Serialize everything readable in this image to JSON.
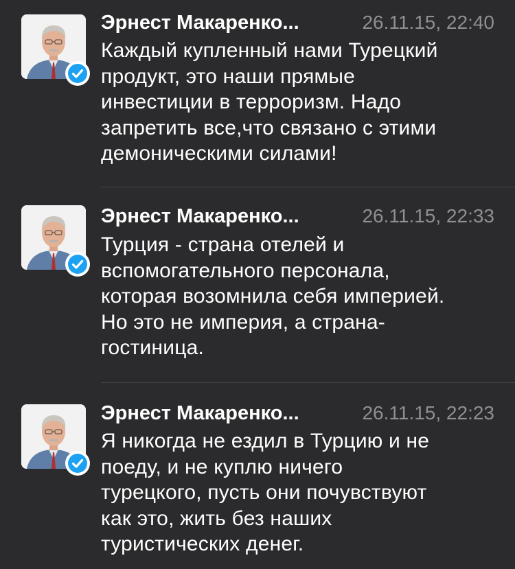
{
  "tweets": [
    {
      "author": "Эрнест Макаренко...",
      "time": "26.11.15, 22:40",
      "lines": [
        "Каждый купленный нами Турецкий",
        "продукт, это наши прямые",
        "инвестиции в терроризм. Надо",
        "запретить все,что связано с этими",
        "демоническими силами!"
      ]
    },
    {
      "author": "Эрнест Макаренко...",
      "time": "26.11.15, 22:33",
      "lines": [
        "Турция - страна отелей и",
        "вспомогательного персонала,",
        "которая возомнила себя империей.",
        "Но это не империя, а страна-",
        "гостиница."
      ]
    },
    {
      "author": "Эрнест Макаренко...",
      "time": "26.11.15, 22:23",
      "lines": [
        "Я никогда не ездил в Турцию и не",
        "поеду, и не куплю ничего",
        "турецкого, пусть они почувствуют",
        "как это, жить без наших",
        "туристических денег."
      ]
    }
  ],
  "icons": {
    "avatar": "profile-photo",
    "badge": "verified-badge-icon"
  },
  "colors": {
    "background": "#2b2b2d",
    "text": "#ffffff",
    "timestamp": "#8e8e93",
    "verified": "#1da1f2",
    "divider": "#444447"
  }
}
